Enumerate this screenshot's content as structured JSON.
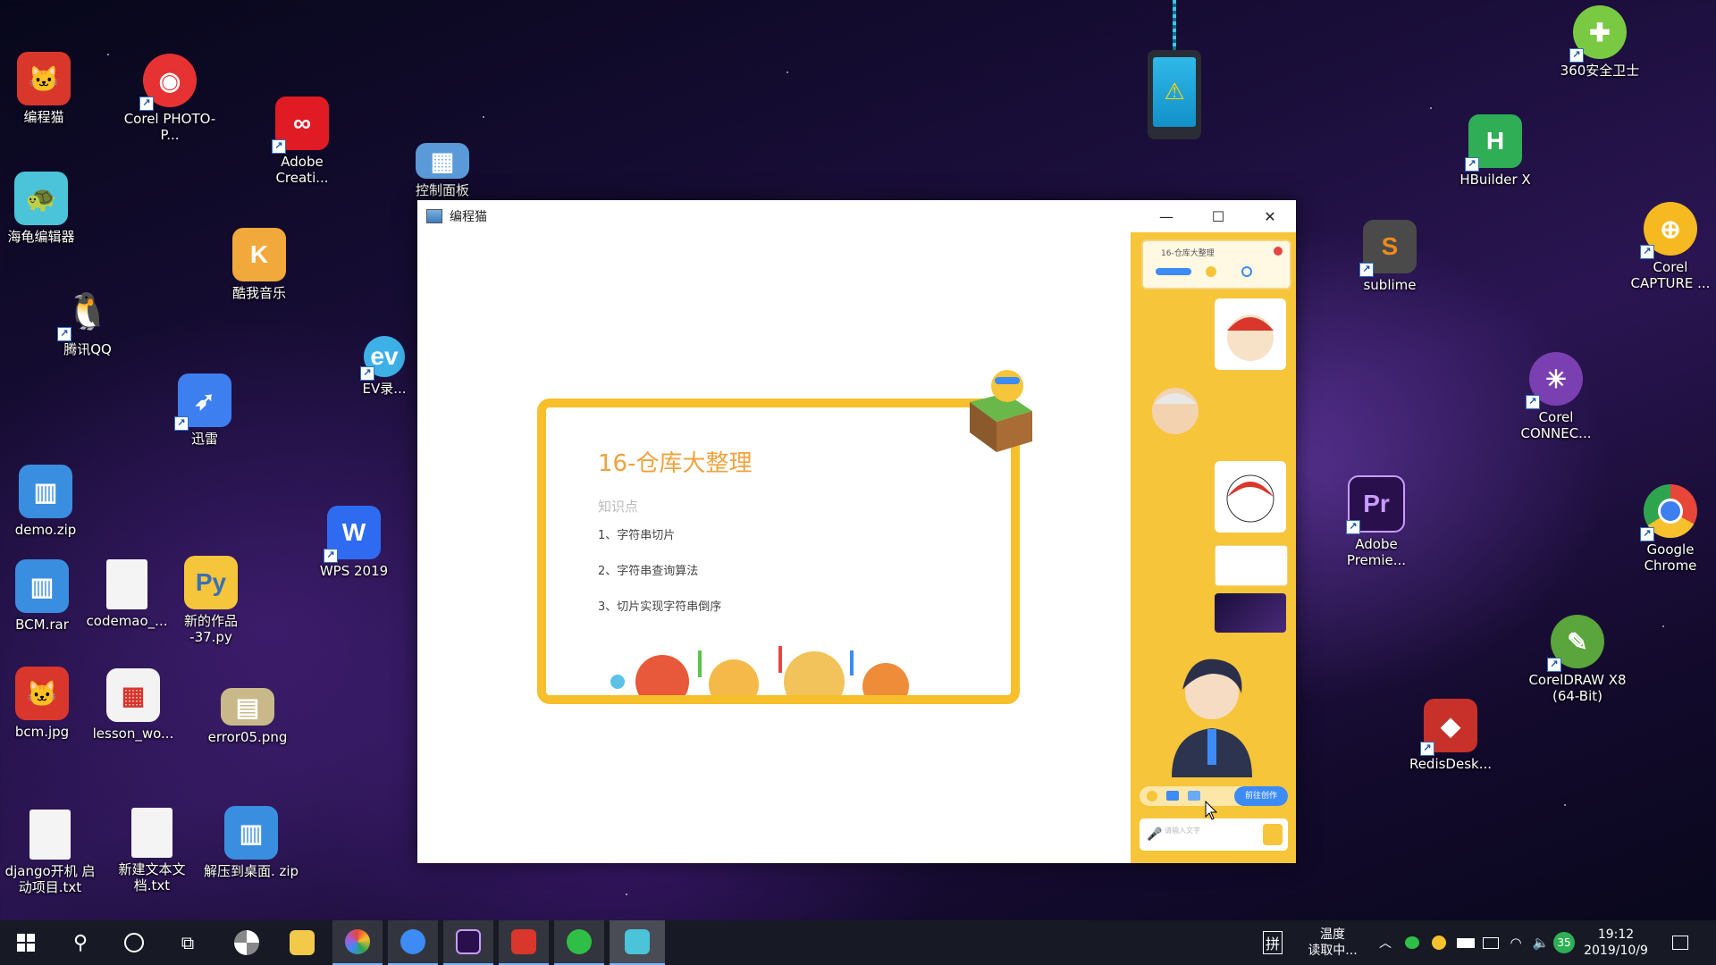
{
  "desktop": {
    "icons_left": [
      {
        "label": "编程猫",
        "color": "#d9362c"
      },
      {
        "label": "Corel PHOTO-P...",
        "color": "#e63232"
      },
      {
        "label": "Adobe Creati...",
        "color": "#e01b24"
      },
      {
        "label": "控制面板",
        "color": "#5a9ad8"
      },
      {
        "label": "海龟编辑器",
        "color": "#4bc3d9"
      },
      {
        "label": "酷我音乐",
        "color": "#f2a93b"
      },
      {
        "label": "腾讯QQ",
        "color": "#111111"
      },
      {
        "label": "EV录...",
        "color": "#3db0e8"
      },
      {
        "label": "迅雷",
        "color": "#3e7ff0"
      },
      {
        "label": "demo.zip",
        "color": "#3a8ee0"
      },
      {
        "label": "WPS 2019",
        "color": "#2f6bf0"
      },
      {
        "label": "BCM.rar",
        "color": "#3a8ee0"
      },
      {
        "label": "codemao_...",
        "color": "#f0f0f0"
      },
      {
        "label": "新的作品 -37.py",
        "color": "#f5c63b"
      },
      {
        "label": "bcm.jpg",
        "color": "#d9362c"
      },
      {
        "label": "lesson_wo...",
        "color": "#f3f3f3"
      },
      {
        "label": "error05.png",
        "color": "#c9b98a"
      },
      {
        "label": "django开机 启动项目.txt",
        "color": "#f0f0f0"
      },
      {
        "label": "新建文本文 档.txt",
        "color": "#f0f0f0"
      },
      {
        "label": "解压到桌面. zip",
        "color": "#3a8ee0"
      }
    ],
    "icons_right": [
      {
        "label": "360安全卫士",
        "color": "#7ac943"
      },
      {
        "label": "HBuilder X",
        "color": "#2fae56"
      },
      {
        "label": "sublime",
        "color": "#f08a1c"
      },
      {
        "label": "Corel CAPTURE ...",
        "color": "#f6b921"
      },
      {
        "label": "Corel CONNEC...",
        "color": "#7a3fb0"
      },
      {
        "label": "Adobe Premie...",
        "color": "#2a0f4d"
      },
      {
        "label": "Google Chrome",
        "color": "#e9463a"
      },
      {
        "label": "CorelDRAW X8 (64-Bit)",
        "color": "#5aa53c"
      },
      {
        "label": "RedisDesk...",
        "color": "#c8302a"
      }
    ]
  },
  "window": {
    "title": "编程猫",
    "minimize": "—",
    "maximize": "☐",
    "close": "✕",
    "slide": {
      "title": "16-仓库大整理",
      "knowledge_label": "知识点",
      "items": [
        "1、字符串切片",
        "2、字符串查询算法",
        "3、切片实现字符串倒序"
      ]
    },
    "panel": {
      "lesson_title": "16-仓库大整理",
      "action_label": "前往创作",
      "input_placeholder": "请输入文字"
    }
  },
  "taskbar": {
    "weather_line1": "温度",
    "weather_line2": "读取中...",
    "time": "19:12",
    "date": "2019/10/9",
    "badge": "35",
    "ime": "拼"
  }
}
